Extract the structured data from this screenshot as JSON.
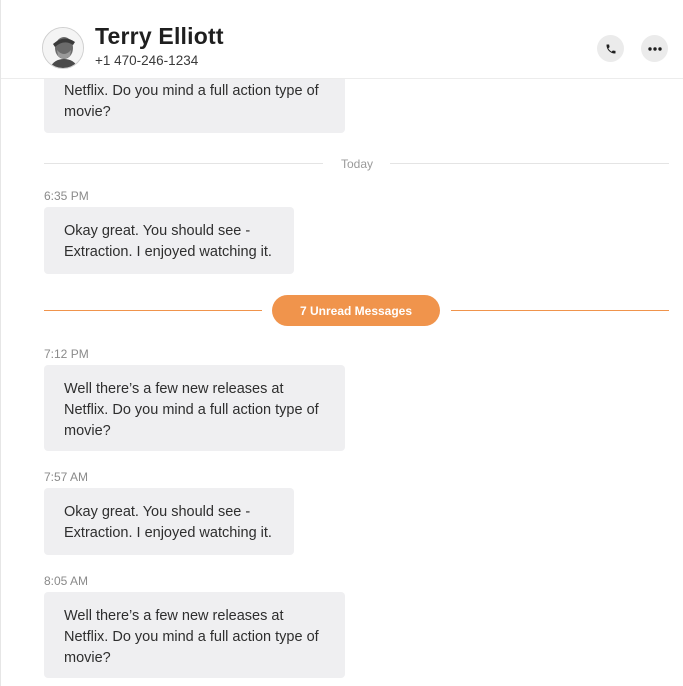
{
  "header": {
    "name": "Terry Elliott",
    "phone": "+1 470-246-1234",
    "avatar_icon": "avatar-photo",
    "call_icon": "phone-icon",
    "more_icon": "more-horizontal-icon"
  },
  "thread": {
    "top_partial_message": [
      "Netflix. Do you mind a full action type of",
      "movie?"
    ],
    "today_label": "Today",
    "unread_label": "7 Unread Messages",
    "messages": [
      {
        "time": "6:35 PM",
        "lines": [
          "Okay great. You should see -",
          "Extraction. I enjoyed watching it."
        ]
      },
      {
        "time": "7:12 PM",
        "lines": [
          "Well there’s a few new releases at",
          "Netflix. Do you mind a full action type of",
          "movie?"
        ]
      },
      {
        "time": "7:57 AM",
        "lines": [
          "Okay great. You should see -",
          "Extraction. I enjoyed watching it."
        ]
      },
      {
        "time": "8:05 AM",
        "lines": [
          "Well there’s a few new releases at",
          "Netflix. Do you mind a full action type of",
          "movie?"
        ]
      }
    ]
  },
  "colors": {
    "accent": "#f0944c",
    "bubble": "#efeff1",
    "divider": "#e4e4e4"
  }
}
